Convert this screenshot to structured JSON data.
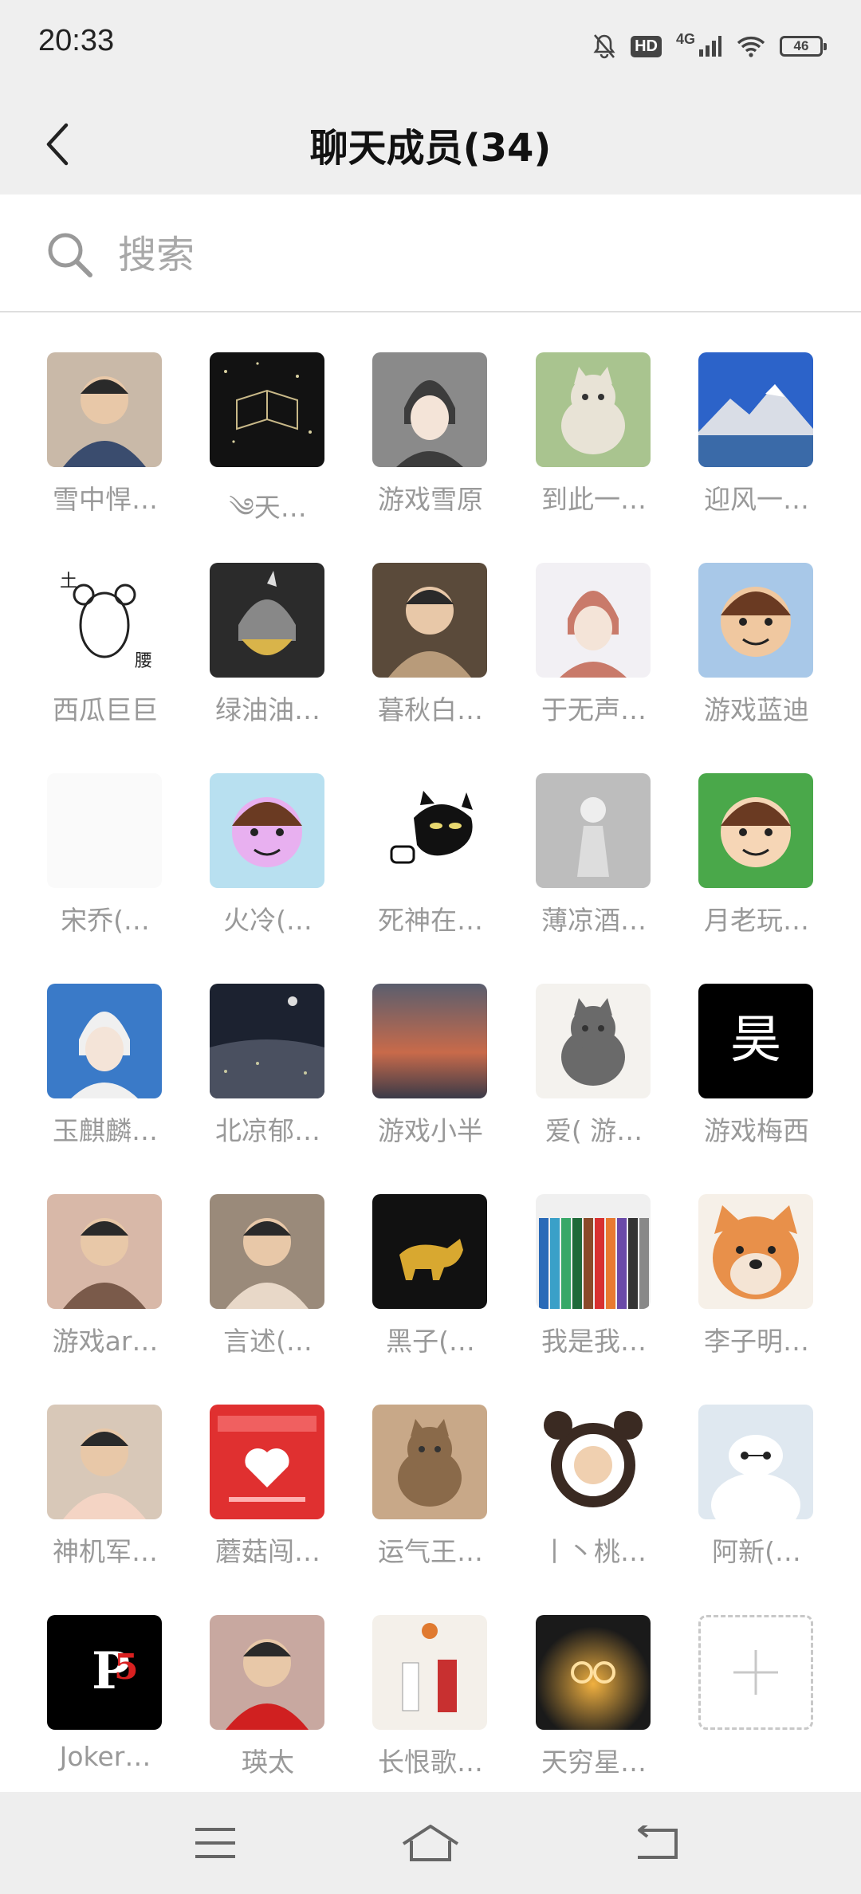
{
  "status_bar": {
    "time": "20:33",
    "network": "4G",
    "hd": "HD",
    "battery": "46"
  },
  "header": {
    "title": "聊天成员(34)"
  },
  "search": {
    "placeholder": "搜索"
  },
  "members": [
    {
      "name": "雪中悍…",
      "colors": [
        "#c9b9a8",
        "#3a4c6e"
      ],
      "art": "person"
    },
    {
      "name": "༄天…",
      "colors": [
        "#121212",
        "#2a2a22"
      ],
      "art": "book"
    },
    {
      "name": "游戏雪原",
      "colors": [
        "#8a8a8a",
        "#3c3c3c"
      ],
      "art": "anime"
    },
    {
      "name": "到此一…",
      "colors": [
        "#a9c48f",
        "#e8e3d6"
      ],
      "art": "cat"
    },
    {
      "name": "迎风一…",
      "colors": [
        "#2c63c9",
        "#d9dde6"
      ],
      "art": "mountain"
    },
    {
      "name": "西瓜巨巨",
      "colors": [
        "#ffffff",
        "#e0e0e0"
      ],
      "art": "sketch"
    },
    {
      "name": "绿油油…",
      "colors": [
        "#2b2b2b",
        "#d9b44a"
      ],
      "art": "helmet"
    },
    {
      "name": "暮秋白…",
      "colors": [
        "#5a4a3a",
        "#b89b7a"
      ],
      "art": "person"
    },
    {
      "name": "于无声…",
      "colors": [
        "#f2f0f4",
        "#c97a6a"
      ],
      "art": "anime"
    },
    {
      "name": "游戏蓝迪",
      "colors": [
        "#a8c8e8",
        "#f0c8a0"
      ],
      "art": "face"
    },
    {
      "name": "宋乔(…",
      "colors": [
        "#fafafa",
        "#f4f4f4"
      ],
      "art": "blank"
    },
    {
      "name": "火冷(…",
      "colors": [
        "#b8e0f0",
        "#e8b0f0"
      ],
      "art": "face"
    },
    {
      "name": "死神在…",
      "colors": [
        "#ffffff",
        "#111111"
      ],
      "art": "blackcat"
    },
    {
      "name": "薄凉酒…",
      "colors": [
        "#bdbdbd",
        "#888888"
      ],
      "art": "statue"
    },
    {
      "name": "月老玩…",
      "colors": [
        "#4aa84a",
        "#f6d6b6"
      ],
      "art": "face"
    },
    {
      "name": "玉麒麟…",
      "colors": [
        "#3a7ac8",
        "#f0f0f0"
      ],
      "art": "anime"
    },
    {
      "name": "北凉郁…",
      "colors": [
        "#1c2230",
        "#4a5060"
      ],
      "art": "night"
    },
    {
      "name": "游戏小半",
      "colors": [
        "#5a5e6e",
        "#c86a4a"
      ],
      "art": "sunset"
    },
    {
      "name": "爱( 游…",
      "colors": [
        "#f4f2ee",
        "#6a6a6a"
      ],
      "art": "cat"
    },
    {
      "name": "游戏梅西",
      "colors": [
        "#000000",
        "#000000"
      ],
      "art": "char",
      "char": "昊"
    },
    {
      "name": "游戏ar…",
      "colors": [
        "#d8b8a8",
        "#7a5a4a"
      ],
      "art": "person"
    },
    {
      "name": "言述(…",
      "colors": [
        "#9a8a7a",
        "#e8d8c8"
      ],
      "art": "person"
    },
    {
      "name": "黑子(…",
      "colors": [
        "#111111",
        "#d8a830"
      ],
      "art": "bull"
    },
    {
      "name": "我是我…",
      "colors": [
        "#f0f0f0",
        "#3aa0c8"
      ],
      "art": "pencils"
    },
    {
      "name": "李子明…",
      "colors": [
        "#e8904a",
        "#f4e4d4"
      ],
      "art": "dog"
    },
    {
      "name": "神机军…",
      "colors": [
        "#d8c8b8",
        "#f4d4c4"
      ],
      "art": "person"
    },
    {
      "name": "蘑菇闯…",
      "colors": [
        "#e03030",
        "#f06060"
      ],
      "art": "poster"
    },
    {
      "name": "运气王…",
      "colors": [
        "#c8a888",
        "#8a6a4a"
      ],
      "art": "cat"
    },
    {
      "name": "丨丶桃…",
      "colors": [
        "#ffffff",
        "#3a2a22"
      ],
      "art": "panda"
    },
    {
      "name": "阿新(…",
      "colors": [
        "#dfe8f0",
        "#ffffff"
      ],
      "art": "baymax"
    },
    {
      "name": "Joker…",
      "colors": [
        "#000000",
        "#d82020"
      ],
      "art": "logo"
    },
    {
      "name": "瑛太",
      "colors": [
        "#c8a8a0",
        "#d02020"
      ],
      "art": "person"
    },
    {
      "name": "长恨歌…",
      "colors": [
        "#f4f0ea",
        "#c83030"
      ],
      "art": "basketball"
    },
    {
      "name": "天穷星…",
      "colors": [
        "#1a1a1a",
        "#f0b040"
      ],
      "art": "glow"
    }
  ],
  "add_member": {
    "icon": "plus-icon"
  },
  "nav": {
    "menu_icon": "menu-icon",
    "home_icon": "home-icon",
    "back_icon": "back-icon"
  }
}
